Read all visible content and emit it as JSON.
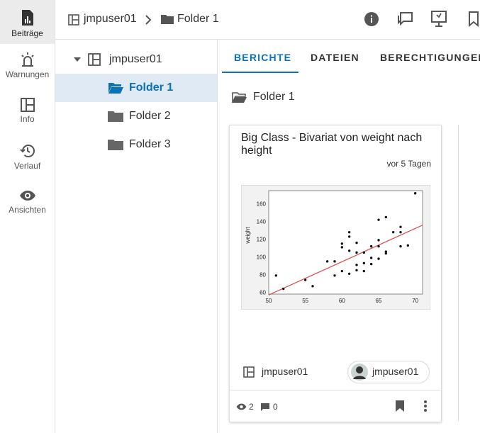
{
  "rail": {
    "items": [
      {
        "label": "Beiträge",
        "icon": "post-icon",
        "active": true
      },
      {
        "label": "Warnungen",
        "icon": "alarm-icon"
      },
      {
        "label": "Info",
        "icon": "info-panel-icon"
      },
      {
        "label": "Verlauf",
        "icon": "history-icon"
      },
      {
        "label": "Ansichten",
        "icon": "eye-icon"
      }
    ]
  },
  "breadcrumb": {
    "root": "jmpuser01",
    "current": "Folder 1"
  },
  "tree": {
    "root": "jmpuser01",
    "folders": [
      "Folder 1",
      "Folder 2",
      "Folder 3"
    ],
    "selected": "Folder 1"
  },
  "tabs": [
    "BERICHTE",
    "DATEIEN",
    "BERECHTIGUNGEN"
  ],
  "active_tab": "BERICHTE",
  "folder_heading": "Folder 1",
  "card": {
    "title": "Big Class - Bivariat von weight nach height",
    "time": "vor 5 Tagen",
    "owner": "jmpuser01",
    "author_chip": "jmpuser01",
    "views": "2",
    "comments": "0"
  },
  "chart_data": {
    "type": "scatter",
    "xlabel": "",
    "ylabel": "weight",
    "xlim": [
      50,
      71
    ],
    "ylim": [
      58,
      175
    ],
    "xticks": [
      50,
      55,
      60,
      65,
      70
    ],
    "yticks": [
      60,
      80,
      100,
      120,
      140,
      160
    ],
    "fit_line": {
      "x": [
        50,
        71
      ],
      "y": [
        57,
        136
      ]
    },
    "points": [
      [
        51,
        79
      ],
      [
        52,
        64
      ],
      [
        55,
        74
      ],
      [
        56,
        67
      ],
      [
        58,
        95
      ],
      [
        59,
        95
      ],
      [
        59,
        79
      ],
      [
        60,
        84
      ],
      [
        60,
        115
      ],
      [
        60,
        111
      ],
      [
        61,
        128
      ],
      [
        61,
        123
      ],
      [
        61,
        107
      ],
      [
        61,
        81
      ],
      [
        62,
        116
      ],
      [
        62,
        91
      ],
      [
        62,
        85
      ],
      [
        62,
        105
      ],
      [
        63,
        93
      ],
      [
        63,
        84
      ],
      [
        63,
        105
      ],
      [
        64,
        112
      ],
      [
        64,
        99
      ],
      [
        64,
        92
      ],
      [
        65,
        142
      ],
      [
        65,
        119
      ],
      [
        65,
        112
      ],
      [
        65,
        98
      ],
      [
        66,
        145
      ],
      [
        66,
        106
      ],
      [
        66,
        104
      ],
      [
        67,
        128
      ],
      [
        68,
        134
      ],
      [
        68,
        128
      ],
      [
        68,
        112
      ],
      [
        69,
        113
      ],
      [
        70,
        172
      ]
    ],
    "colors": {
      "points": "#111111",
      "fit": "#d9534f"
    }
  },
  "colors": {
    "accent": "#0b72b8",
    "selected_bg": "#dfeaf4"
  }
}
